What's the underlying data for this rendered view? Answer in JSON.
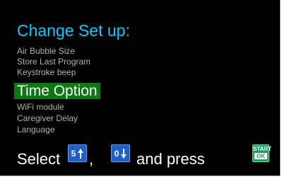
{
  "screen": {
    "title": "Change Set up:",
    "menu_items": [
      {
        "label": "Air Bubble Size",
        "selected": false
      },
      {
        "label": "Store Last Program",
        "selected": false
      },
      {
        "label": "Keystroke beep",
        "selected": false
      },
      {
        "label": "Time Option",
        "selected": true
      },
      {
        "label": "WiFi module",
        "selected": false
      },
      {
        "label": "Caregiver Delay",
        "selected": false
      },
      {
        "label": "Language",
        "selected": false
      }
    ],
    "footer": {
      "select_text": "Select",
      "comma": ",",
      "and_press_text": "and press"
    },
    "keys": {
      "up_key": {
        "digit": "5",
        "icon": "arrow-up-icon"
      },
      "down_key": {
        "digit": "0",
        "icon": "arrow-down-icon"
      },
      "start_ok_key": {
        "top": "START",
        "bottom": "OK"
      }
    },
    "colors": {
      "background": "#000000",
      "title": "#00ccff",
      "menu_text": "#b0b0b0",
      "selected_bg": "#0a7a10",
      "selected_text": "#ffffff",
      "key_blue": "#1e5fc8",
      "key_green": "#13a35a"
    }
  }
}
